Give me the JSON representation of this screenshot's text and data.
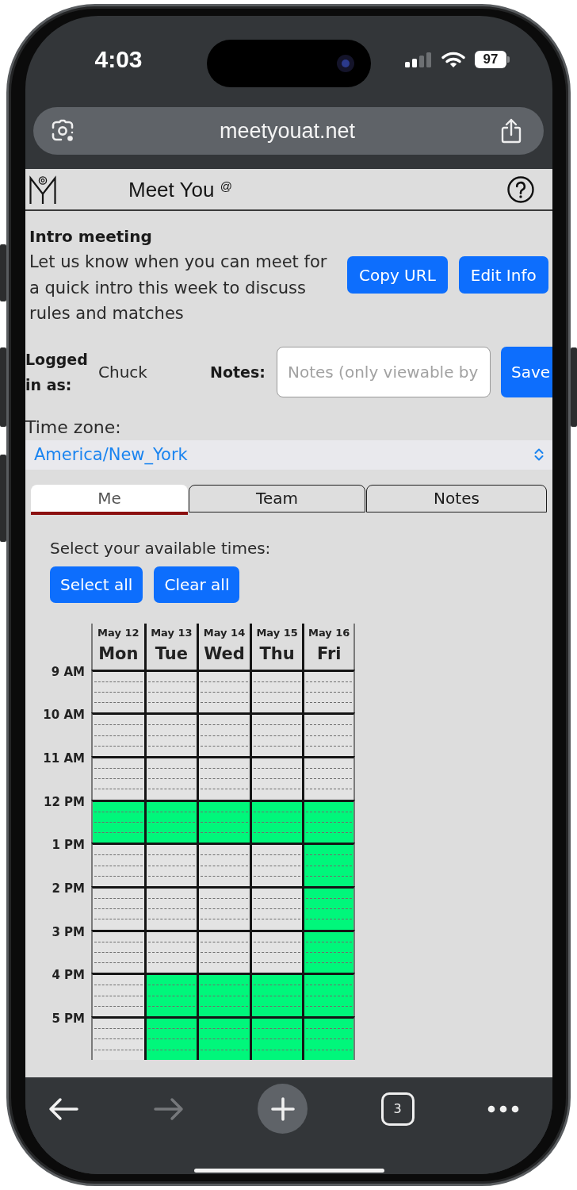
{
  "status_bar": {
    "time": "4:03",
    "battery": "97"
  },
  "browser": {
    "url": "meetyouat.net"
  },
  "header": {
    "title": "Meet You $^{@}$"
  },
  "intro": {
    "title": "Intro meeting",
    "text": "Let us know when you can meet for a quick intro this week to discuss rules and matches",
    "buttons": [
      {
        "label": "Copy URL"
      },
      {
        "label": "Edit Info"
      }
    ]
  },
  "login": {
    "label": "Logged in as:",
    "user": "Chuck",
    "notes_label": "Notes:",
    "notes_field": {
      "placeholder": "Notes (only viewable by"
    },
    "save_button": "Save"
  },
  "timezone": {
    "label": "Time zone:",
    "value": "America/New_York"
  },
  "tabs": [
    {
      "label": "Me",
      "selected": true
    },
    {
      "label": "Team",
      "selected": false
    },
    {
      "label": "Notes",
      "selected": false
    }
  ],
  "availability": {
    "prompt": "Select your available times:",
    "buttons": [
      {
        "label": "Select all"
      },
      {
        "label": "Clear all"
      }
    ],
    "days": [
      {
        "date": "May 12",
        "day": "Mon"
      },
      {
        "date": "May 13",
        "day": "Tue"
      },
      {
        "date": "May 14",
        "day": "Wed"
      },
      {
        "date": "May 15",
        "day": "Thu"
      },
      {
        "date": "May 16",
        "day": "Fri"
      }
    ],
    "hours": [
      {
        "label": "9 AM",
        "slots": [
          {
            "selected": false
          },
          {
            "selected": false
          },
          {
            "selected": false
          },
          {
            "selected": false
          },
          {
            "selected": false
          }
        ]
      },
      {
        "label": "10 AM",
        "slots": [
          {
            "selected": false
          },
          {
            "selected": false
          },
          {
            "selected": false
          },
          {
            "selected": false
          },
          {
            "selected": false
          }
        ]
      },
      {
        "label": "11 AM",
        "slots": [
          {
            "selected": false
          },
          {
            "selected": false
          },
          {
            "selected": false
          },
          {
            "selected": false
          },
          {
            "selected": false
          }
        ]
      },
      {
        "label": "12 PM",
        "slots": [
          {
            "selected": true
          },
          {
            "selected": true
          },
          {
            "selected": true
          },
          {
            "selected": true
          },
          {
            "selected": true
          }
        ]
      },
      {
        "label": "1 PM",
        "slots": [
          {
            "selected": false
          },
          {
            "selected": false
          },
          {
            "selected": false
          },
          {
            "selected": false
          },
          {
            "selected": true
          }
        ]
      },
      {
        "label": "2 PM",
        "slots": [
          {
            "selected": false
          },
          {
            "selected": false
          },
          {
            "selected": false
          },
          {
            "selected": false
          },
          {
            "selected": true
          }
        ]
      },
      {
        "label": "3 PM",
        "slots": [
          {
            "selected": false
          },
          {
            "selected": false
          },
          {
            "selected": false
          },
          {
            "selected": false
          },
          {
            "selected": true
          }
        ]
      },
      {
        "label": "4 PM",
        "slots": [
          {
            "selected": false
          },
          {
            "selected": true
          },
          {
            "selected": true
          },
          {
            "selected": true
          },
          {
            "selected": true
          }
        ]
      },
      {
        "label": "5 PM",
        "slots": [
          {
            "selected": false
          },
          {
            "selected": true
          },
          {
            "selected": true
          },
          {
            "selected": true
          },
          {
            "selected": true
          }
        ]
      }
    ]
  },
  "toolbar": {
    "back": {
      "disabled": false
    },
    "forward": {
      "disabled": true
    },
    "tab_count": "3"
  }
}
